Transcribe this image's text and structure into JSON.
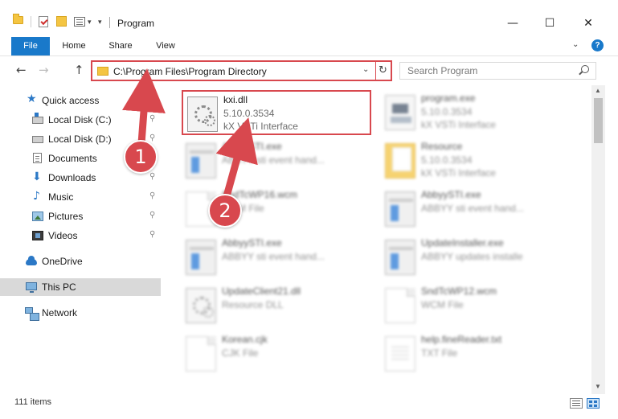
{
  "window": {
    "title": "Program",
    "minimize_glyph": "—",
    "maximize_glyph": "☐",
    "close_glyph": "✕",
    "qa_chevron_glyph": "▾",
    "qa_down_glyph": "▾"
  },
  "ribbon": {
    "tabs": [
      {
        "label": "File"
      },
      {
        "label": "Home"
      },
      {
        "label": "Share"
      },
      {
        "label": "View"
      }
    ],
    "collapse_glyph": "⌄",
    "help_glyph": "?"
  },
  "nav": {
    "back_glyph": "←",
    "forward_glyph": "→",
    "up_glyph": "↑",
    "address": "C:\\Program Files\\Program Directory",
    "address_dropdown_glyph": "⌄",
    "refresh_glyph": "↻",
    "search_placeholder": "Search Program"
  },
  "sidebar": {
    "pin_glyph": "⚲",
    "items": [
      {
        "label": "Quick access",
        "icon": "star-icon",
        "glyph": "★"
      },
      {
        "label": "Local Disk (C:)",
        "icon": "disk-icon"
      },
      {
        "label": "Local Disk (D:)",
        "icon": "disk-icon"
      },
      {
        "label": "Documents",
        "icon": "documents-icon"
      },
      {
        "label": "Downloads",
        "icon": "download-icon",
        "glyph": "⬇"
      },
      {
        "label": "Music",
        "icon": "music-icon",
        "glyph": "♪"
      },
      {
        "label": "Pictures",
        "icon": "pictures-icon"
      },
      {
        "label": "Videos",
        "icon": "videos-icon"
      },
      {
        "label": "OneDrive",
        "icon": "cloud-icon"
      },
      {
        "label": "This PC",
        "icon": "computer-icon"
      },
      {
        "label": "Network",
        "icon": "network-icon"
      }
    ]
  },
  "files": [
    {
      "name": "kxi.dll",
      "line2": "5.10.0.3534",
      "line3": "kX VSTi Interface",
      "icon": "dll-icon"
    },
    {
      "name": "program.exe",
      "line2": "5.10.0.3534",
      "line3": "kX VSTi Interface",
      "icon": "program-icon"
    },
    {
      "name": "AbbyySTI.exe",
      "line2": "ABBYY sti event hand...",
      "line3": "",
      "icon": "exe-icon"
    },
    {
      "name": "Resource",
      "line2": "5.10.0.3534",
      "line3": "kX VSTi Interface",
      "icon": "folder-icon"
    },
    {
      "name": "SndTcWP16.wcm",
      "line2": "WCM File",
      "line3": "",
      "icon": "file-icon"
    },
    {
      "name": "AbbyySTI.exe",
      "line2": "ABBYY sti event hand...",
      "line3": "",
      "icon": "exe-icon"
    },
    {
      "name": "AbbyySTI.exe",
      "line2": "ABBYY sti event hand...",
      "line3": "",
      "icon": "exe-icon"
    },
    {
      "name": "UpdateInstaller.exe",
      "line2": "ABBYY updates installe",
      "line3": "",
      "icon": "exe-icon"
    },
    {
      "name": "UpdateClient21.dll",
      "line2": "Resource DLL",
      "line3": "",
      "icon": "dll-icon"
    },
    {
      "name": "SndTcWP12.wcm",
      "line2": "WCM File",
      "line3": "",
      "icon": "file-icon"
    },
    {
      "name": "Korean.cjk",
      "line2": "CJK File",
      "line3": "",
      "icon": "file-icon"
    },
    {
      "name": "help.fineReader.txt",
      "line2": "TXT File",
      "line3": "",
      "icon": "text-file-icon"
    }
  ],
  "scrollbar": {
    "up_glyph": "▲",
    "down_glyph": "▼"
  },
  "status": {
    "item_count": "111 items"
  },
  "annotations": {
    "step1": "1",
    "step2": "2",
    "accent": "#d8484e"
  }
}
